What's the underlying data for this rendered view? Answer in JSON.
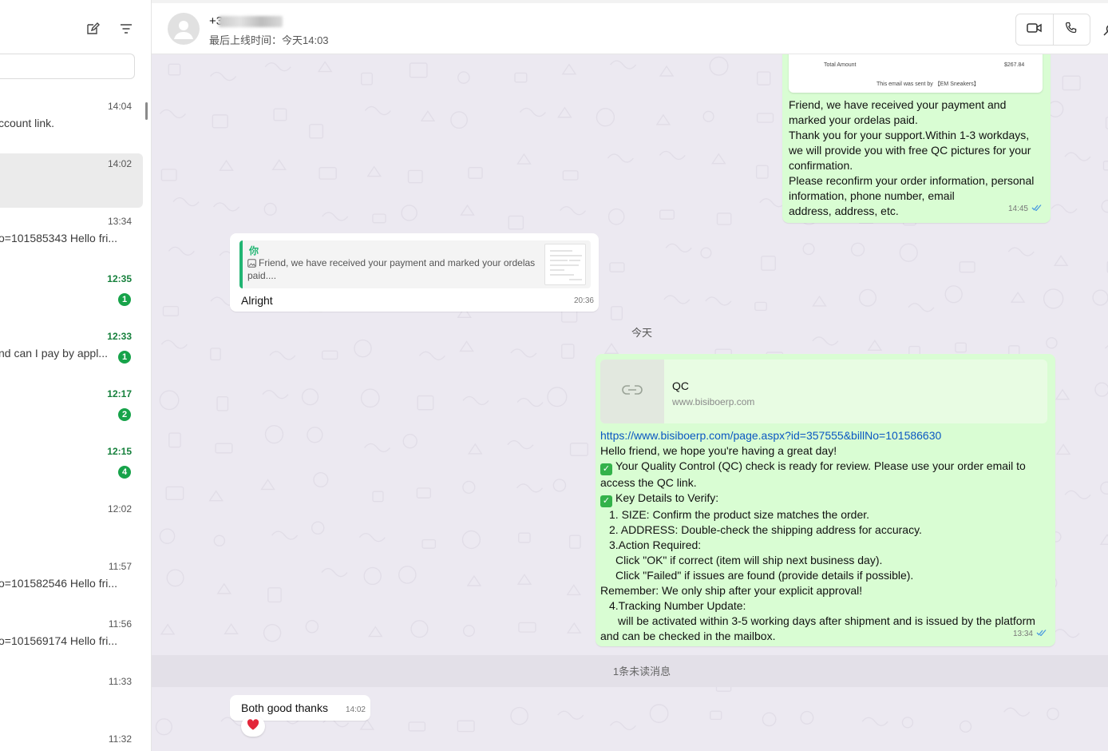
{
  "sidebar": {
    "chats": [
      {
        "time": "14:04",
        "preview": "ccount link.",
        "unread": null,
        "selected": false
      },
      {
        "time": "14:02",
        "preview": "",
        "unread": null,
        "selected": true
      },
      {
        "time": "13:34",
        "preview": "o=101585343 Hello fri...",
        "unread": null,
        "selected": false
      },
      {
        "time": "12:35",
        "preview": "",
        "unread": "1",
        "selected": false
      },
      {
        "time": "12:33",
        "preview": "nd can I pay by appl...",
        "unread": "1",
        "selected": false
      },
      {
        "time": "12:17",
        "preview": "",
        "unread": "2",
        "selected": false
      },
      {
        "time": "12:15",
        "preview": "",
        "unread": "4",
        "selected": false
      },
      {
        "time": "12:02",
        "preview": "",
        "unread": null,
        "selected": false
      },
      {
        "time": "11:57",
        "preview": "o=101582546 Hello fri...",
        "unread": null,
        "selected": false
      },
      {
        "time": "11:56",
        "preview": "o=101569174 Hello fri...",
        "unread": null,
        "selected": false
      },
      {
        "time": "11:33",
        "preview": "",
        "unread": null,
        "selected": false
      },
      {
        "time": "11:32",
        "preview": "",
        "unread": null,
        "selected": false
      }
    ]
  },
  "header": {
    "contact_name": "+3",
    "last_seen": "最后上线时间：今天14:03"
  },
  "messages": {
    "email_card": {
      "total_label": "Total Amount",
      "total_value": "$267.84",
      "footer": "This email was sent by 【EM Sneakers】"
    },
    "payment_msg": {
      "lines": [
        "Friend, we have received your payment and",
        "marked your ordelas paid.",
        "Thank you for your support.Within 1-3 workdays,",
        "we will provide you with free QC pictures for your",
        "confirmation.",
        "Please reconfirm your order information, personal",
        "information, phone number, email",
        "address, address, etc."
      ],
      "time": "14:45"
    },
    "reply": {
      "quote_author": "你",
      "quote_text": "Friend, we have received your payment and marked your ordelas paid....",
      "text": "Alright",
      "time": "20:36"
    },
    "date_divider": "今天",
    "qc_msg": {
      "preview_title": "QC",
      "preview_domain": "www.bisiboerp.com",
      "link": "https://www.bisiboerp.com/page.aspx?id=357555&billNo=101586630",
      "greeting": "Hello friend, we hope you're having a great day!",
      "line_qc_ready": "Your Quality Control (QC) check is ready for review. Please use your order email to",
      "line_qc_ready_2": "access the QC link.",
      "line_key": "Key Details to Verify:",
      "item_size": "1. SIZE: Confirm the product size matches the order.",
      "item_address": "2. ADDRESS: Double-check the shipping address for accuracy.",
      "item_action": "3.Action Required:",
      "item_ok": "Click \"OK\" if correct (item will ship next business day).",
      "item_failed": "Click \"Failed\" if issues are found (provide details if possible).",
      "remember": "Remember: We only ship after your explicit approval!",
      "item_tracking": "4.Tracking Number Update:",
      "item_tracking_2": "will be activated within 3-5 working days after shipment and is issued by the platform",
      "item_tracking_3": "and can be checked in the mailbox.",
      "time": "13:34"
    },
    "unread_divider": "1条未读消息",
    "last_msg": {
      "text": "Both good thanks",
      "time": "14:02",
      "reaction": "heart"
    }
  },
  "colors": {
    "outgoing_bubble": "#d9fdd3",
    "incoming_bubble": "#ffffff",
    "chat_background": "#ece9f1",
    "unread_badge": "#17a34a",
    "read_ticks": "#4a9be0",
    "link": "#0a57c2"
  }
}
